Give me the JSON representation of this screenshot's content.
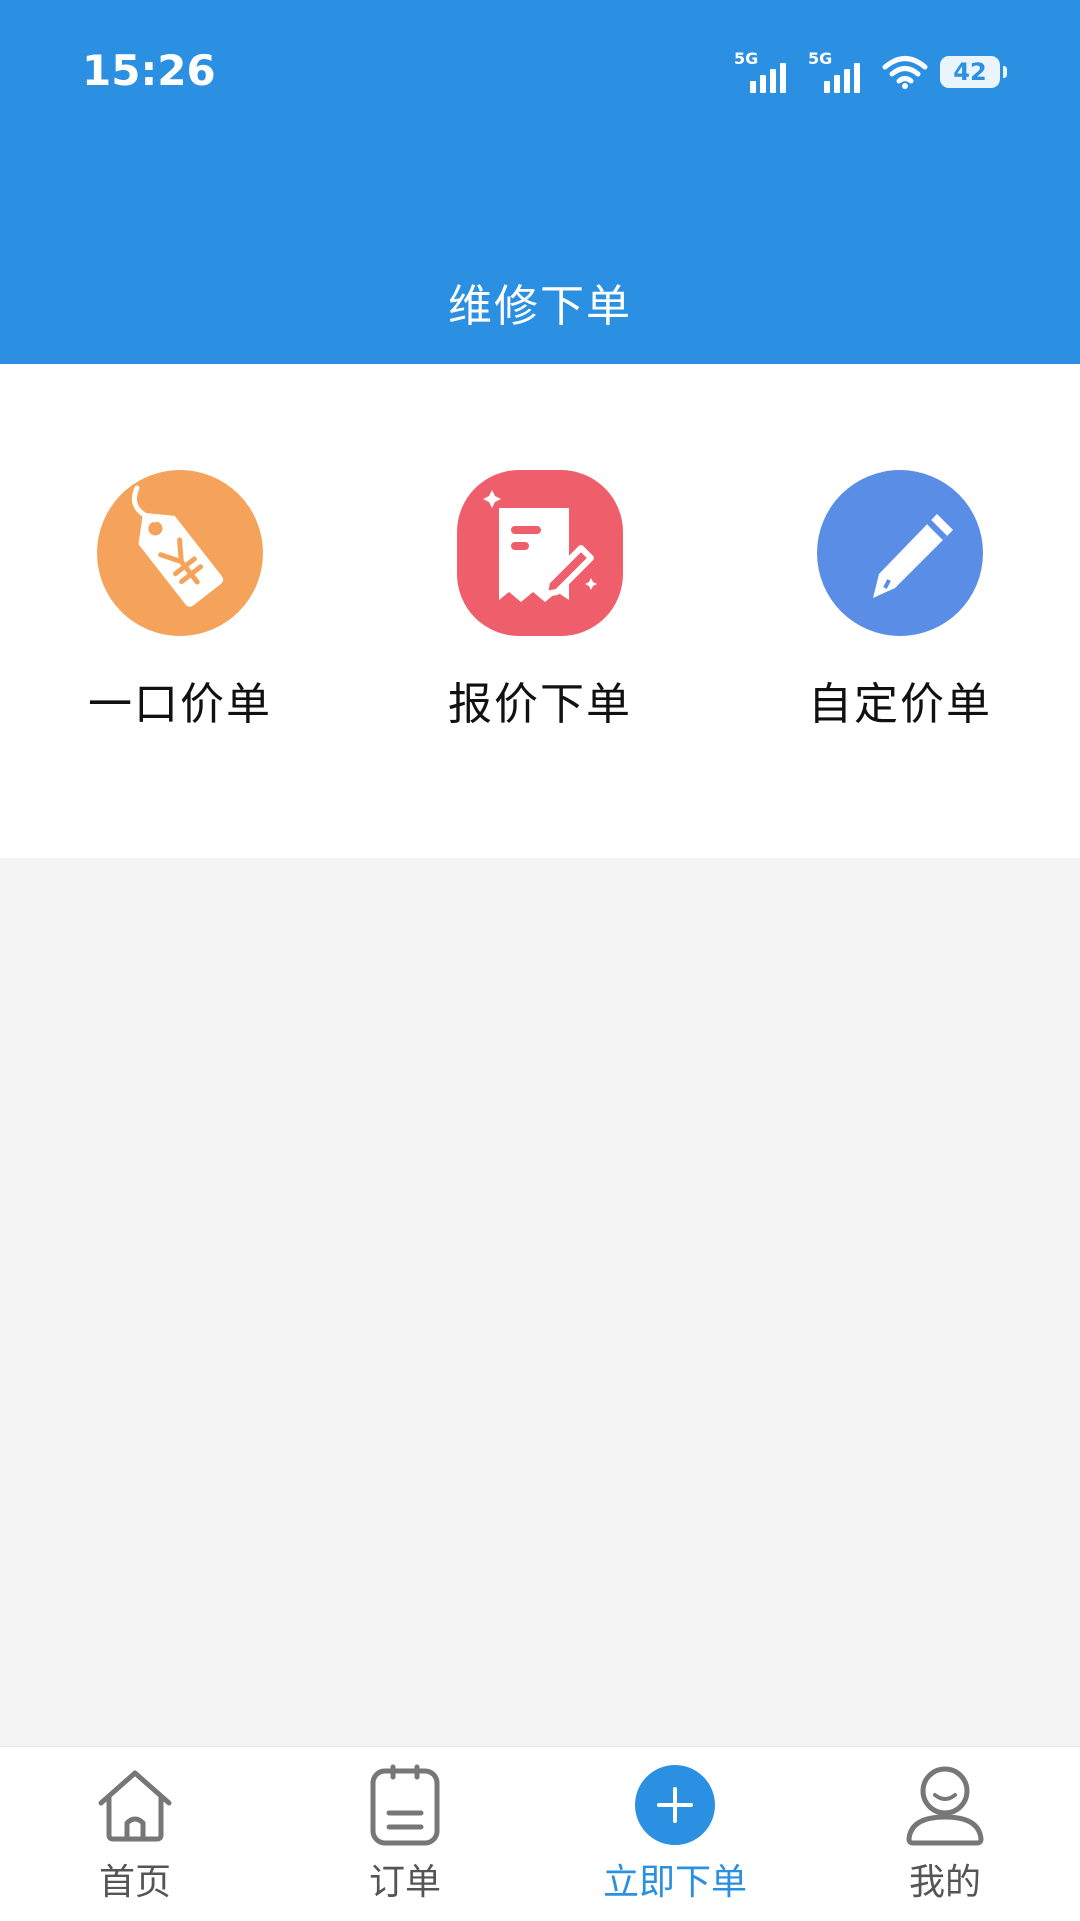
{
  "status_bar": {
    "time": "15:26",
    "signal_1_label": "5G",
    "signal_2_label": "5G",
    "battery": "42"
  },
  "header": {
    "title": "维修下单",
    "background_color": "#2b90e2"
  },
  "menu": {
    "items": [
      {
        "label": "一口价单",
        "icon": "price-tag-icon",
        "color": "#f5a35a"
      },
      {
        "label": "报价下单",
        "icon": "quote-document-icon",
        "color": "#ee5e6b"
      },
      {
        "label": "自定价单",
        "icon": "edit-pencil-icon",
        "color": "#5a8ee6"
      }
    ]
  },
  "tabbar": {
    "active_color": "#2b90e2",
    "items": [
      {
        "label": "首页",
        "icon": "home-icon",
        "active": false
      },
      {
        "label": "订单",
        "icon": "order-clipboard-icon",
        "active": false
      },
      {
        "label": "立即下单",
        "icon": "plus-circle-icon",
        "active": true
      },
      {
        "label": "我的",
        "icon": "user-profile-icon",
        "active": false
      }
    ]
  }
}
